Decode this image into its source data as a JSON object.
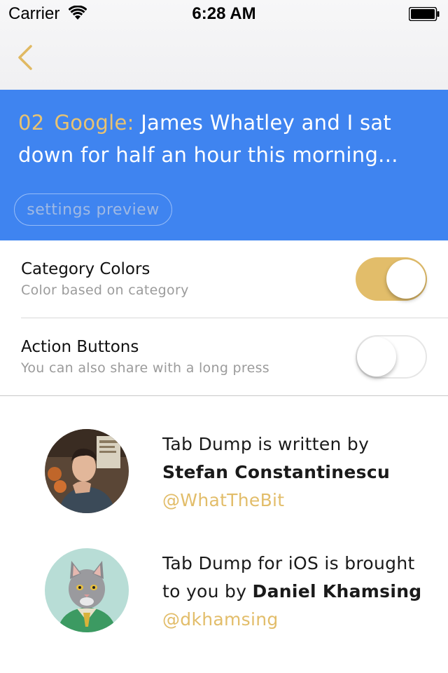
{
  "status_bar": {
    "carrier": "Carrier",
    "time": "6:28 AM"
  },
  "nav": {
    "back_icon": "chevron-left-icon"
  },
  "preview": {
    "number": "02",
    "category": "Google:",
    "text": "James Whatley and I sat down for half an hour this morning...",
    "button_label": "settings preview",
    "background_color": "#3f84f0",
    "accent_color": "#e8c372"
  },
  "settings": [
    {
      "title": "Category Colors",
      "subtitle": "Color based on category",
      "enabled": true
    },
    {
      "title": "Action Buttons",
      "subtitle": "You can also share with a long press",
      "enabled": false
    }
  ],
  "credits": [
    {
      "line1": "Tab Dump is written by",
      "name": "Stefan Constantinescu",
      "handle": "@WhatTheBit"
    },
    {
      "line1": "Tab Dump for iOS is brought to you by",
      "name": "Daniel Khamsing",
      "handle": "@dkhamsing"
    }
  ],
  "colors": {
    "toggle_on": "#e2bd6a",
    "handle": "#e2bd6a"
  }
}
